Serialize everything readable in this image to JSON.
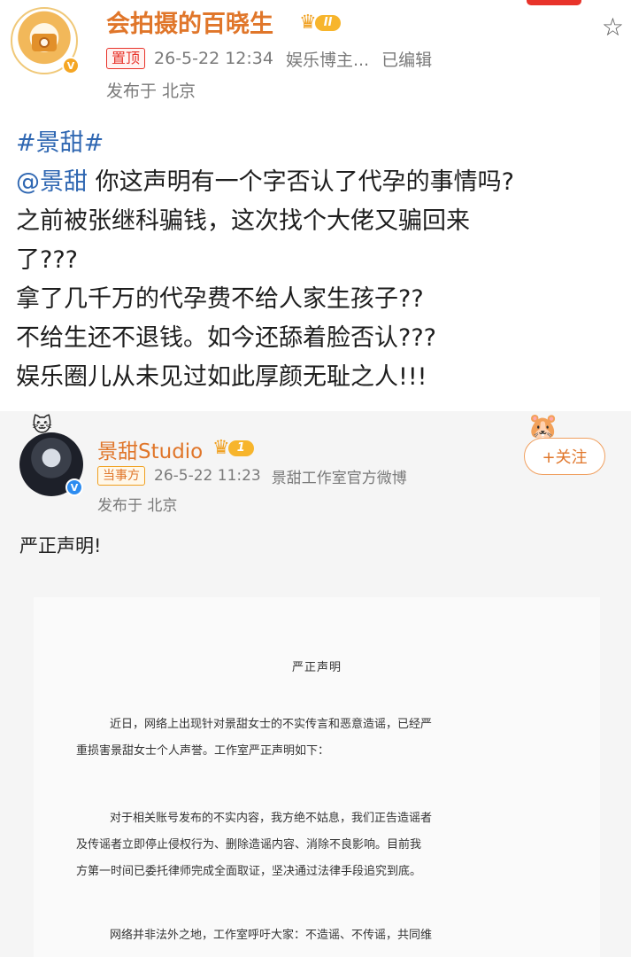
{
  "author": {
    "name": "会拍摄的百晓生",
    "level_badge": "II",
    "pin_tag": "置顶",
    "datetime": "26-5-22 12:34",
    "description": "娱乐博主...",
    "edited": "已编辑",
    "location": "发布于 北京",
    "verified_mark": "V"
  },
  "post": {
    "hashtag": "#景甜#",
    "mention": "@景甜",
    "lines": [
      " 你这声明有一个字否认了代孕的事情吗?",
      "之前被张继科骗钱，这次找个大佬又骗回来",
      "了???",
      "拿了几千万的代孕费不给人家生孩子??",
      "不给生还不退钱。如今还舔着脸否认???",
      "娱乐圈儿从未见过如此厚颜无耻之人!!!"
    ]
  },
  "repost": {
    "name": "景甜Studio",
    "level_badge": "1",
    "party_tag": "当事方",
    "datetime": "26-5-22 11:23",
    "description": "景甜工作室官方微博",
    "location": "发布于 北京",
    "follow_label": "+关注",
    "text": "严正声明!",
    "verified_mark": "V"
  },
  "document": {
    "title": "严正声明",
    "lines": [
      "近日，网络上出现针对景甜女士的不实传言和恶意造谣，已经严",
      "重损害景甜女士个人声誉。工作室严正声明如下：",
      "对于相关账号发布的不实内容，我方绝不姑息，我们正告造谣者",
      "及传谣者立即停止侵权行为、删除造谣内容、消除不良影响。目前我",
      "方第一时间已委托律师完成全面取证，坚决通过法律手段追究到底。",
      "网络并非法外之地，工作室呼吁大家：不造谣、不传谣，共同维"
    ]
  },
  "icons": {
    "star": "star-icon",
    "crown": "crown-icon"
  },
  "colors": {
    "username": "#e0762a",
    "mention": "#2f67b2",
    "pin": "#e8332a"
  }
}
